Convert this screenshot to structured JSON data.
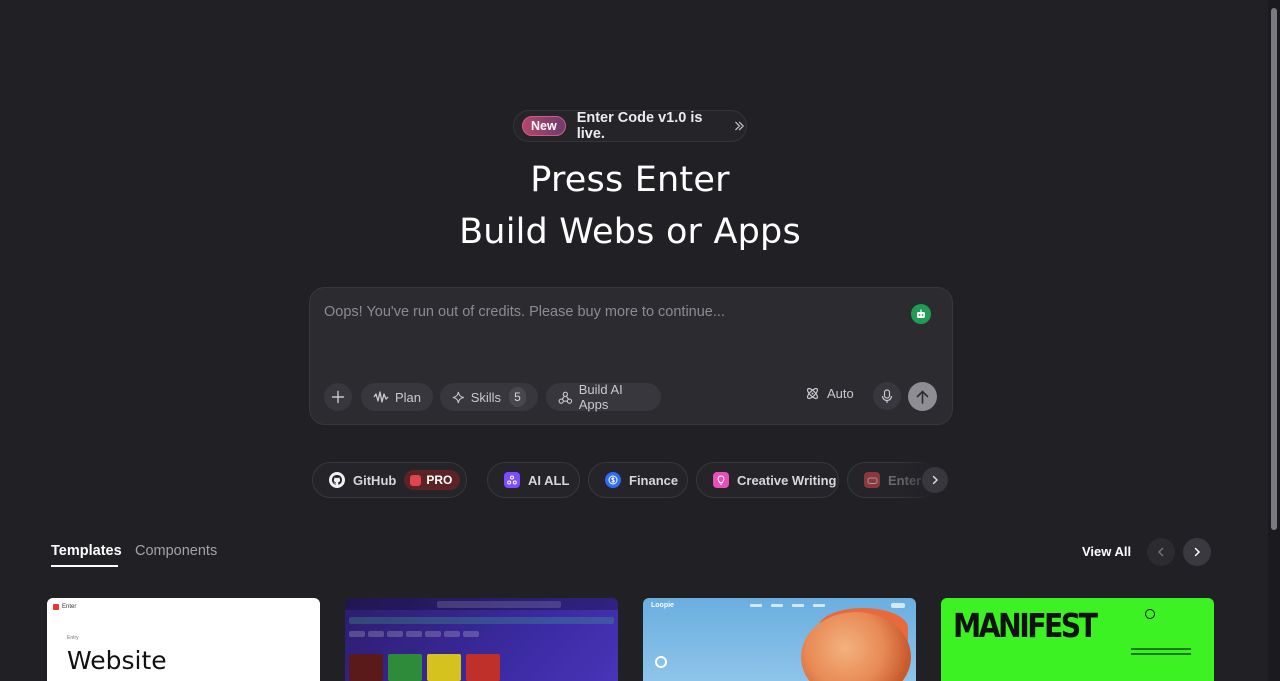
{
  "announcement": {
    "badge": "New",
    "text": "Enter Code v1.0 is live."
  },
  "hero": {
    "line1": "Press Enter",
    "line2": "Build Webs or Apps"
  },
  "prompt": {
    "placeholder": "Oops! You've run out of credits. Please buy more to continue...",
    "plan_label": "Plan",
    "skills_label": "Skills",
    "skills_count": "5",
    "build_label": "Build AI Apps",
    "model_label": "Auto"
  },
  "categories": [
    {
      "label": "GitHub",
      "badge": "PRO",
      "color": "#e6e6e6"
    },
    {
      "label": "AI ALL",
      "color": "#7c4dff"
    },
    {
      "label": "Finance",
      "color": "#2f6df6"
    },
    {
      "label": "Creative Writing",
      "color": "#e84fb6"
    },
    {
      "label": "Enter",
      "color": "#e2454f"
    }
  ],
  "tabs": {
    "templates": "Templates",
    "components": "Components",
    "view_all": "View All"
  },
  "cards": {
    "card1_logo": "Enter",
    "card1_small": "Entry",
    "card1_title": "Website",
    "card3_logo": "Loopie",
    "card4_title": "MANIFEST"
  }
}
